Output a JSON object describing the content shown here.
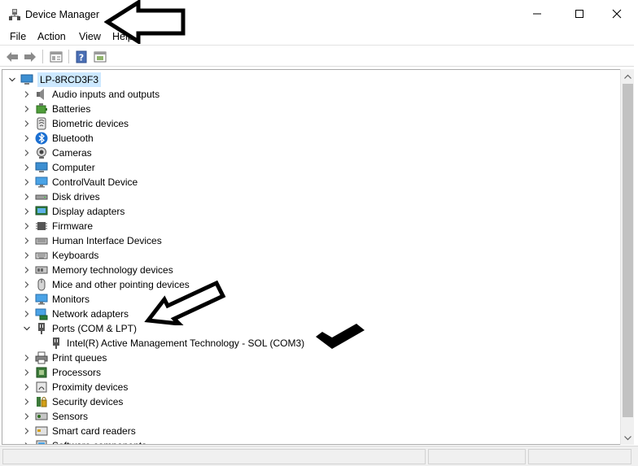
{
  "window": {
    "title": "Device Manager",
    "controls": {
      "minimize": "minimize",
      "maximize": "maximize",
      "close": "close"
    }
  },
  "menu": [
    "File",
    "Action",
    "View",
    "Help"
  ],
  "toolbar": {
    "buttons": [
      "back-arrow-icon",
      "forward-arrow-icon",
      "properties-icon",
      "help-icon",
      "update-driver-icon"
    ]
  },
  "tree": {
    "root": "LP-8RCD3F3",
    "categories": [
      {
        "label": "Audio inputs and outputs",
        "icon": "speaker-icon"
      },
      {
        "label": "Batteries",
        "icon": "battery-icon"
      },
      {
        "label": "Biometric devices",
        "icon": "fingerprint-icon"
      },
      {
        "label": "Bluetooth",
        "icon": "bluetooth-icon"
      },
      {
        "label": "Cameras",
        "icon": "camera-icon"
      },
      {
        "label": "Computer",
        "icon": "computer-icon"
      },
      {
        "label": "ControlVault Device",
        "icon": "monitor-icon"
      },
      {
        "label": "Disk drives",
        "icon": "disk-drive-icon"
      },
      {
        "label": "Display adapters",
        "icon": "display-adapter-icon"
      },
      {
        "label": "Firmware",
        "icon": "chip-icon"
      },
      {
        "label": "Human Interface Devices",
        "icon": "hid-icon"
      },
      {
        "label": "Keyboards",
        "icon": "keyboard-icon"
      },
      {
        "label": "Memory technology devices",
        "icon": "memory-icon"
      },
      {
        "label": "Mice and other pointing devices",
        "icon": "mouse-icon"
      },
      {
        "label": "Monitors",
        "icon": "monitor-icon"
      },
      {
        "label": "Network adapters",
        "icon": "network-icon"
      },
      {
        "label": "Ports (COM & LPT)",
        "icon": "port-icon",
        "expanded": true,
        "children": [
          {
            "label": "Intel(R) Active Management Technology - SOL (COM3)",
            "icon": "port-icon"
          }
        ]
      },
      {
        "label": "Print queues",
        "icon": "printer-icon"
      },
      {
        "label": "Processors",
        "icon": "processor-icon"
      },
      {
        "label": "Proximity devices",
        "icon": "proximity-icon"
      },
      {
        "label": "Security devices",
        "icon": "security-icon"
      },
      {
        "label": "Sensors",
        "icon": "sensor-icon"
      },
      {
        "label": "Smart card readers",
        "icon": "smart-card-icon"
      },
      {
        "label": "Software components",
        "icon": "software-icon"
      }
    ]
  },
  "colors": {
    "selection": "#cce8ff",
    "annotation": "#000000"
  }
}
